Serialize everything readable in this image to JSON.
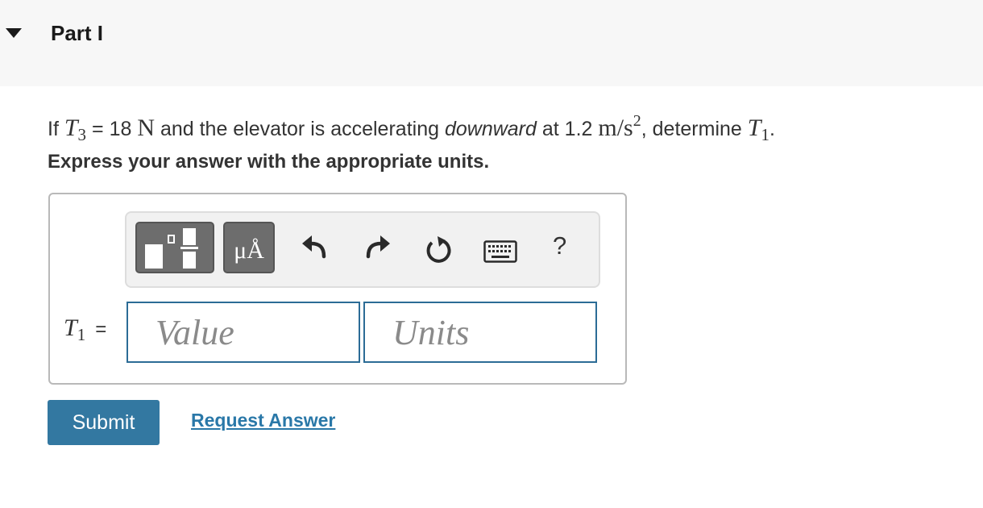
{
  "header": {
    "part_title": "Part I",
    "collapse_icon": "caret-down-icon"
  },
  "question": {
    "prefix": "If",
    "var_t3": "T",
    "var_t3_sub": "3",
    "equals": "=",
    "t3_value": "18",
    "t3_unit": "N",
    "middle": "and the elevator is accelerating",
    "emphasis": "downward",
    "at": "at",
    "accel_value": "1.2",
    "accel_unit": "m/s",
    "accel_unit_exp": "2",
    "determine": ", determine",
    "var_t1": "T",
    "var_t1_sub": "1",
    "end": "."
  },
  "instruction": "Express your answer with the appropriate units.",
  "toolbar": {
    "templates_icon": "templates-icon",
    "units_label": "μÅ",
    "undo_icon": "undo-icon",
    "redo_icon": "redo-icon",
    "reset_icon": "reset-icon",
    "keyboard_icon": "keyboard-icon",
    "help_label": "?"
  },
  "answer": {
    "var": "T",
    "var_sub": "1",
    "equals": "=",
    "value_placeholder": "Value",
    "value": "",
    "units_placeholder": "Units",
    "units": ""
  },
  "actions": {
    "submit_label": "Submit",
    "request_answer_label": "Request Answer"
  },
  "colors": {
    "header_bg": "#f7f7f7",
    "input_border": "#2c6c96",
    "submit_bg": "#3378a1",
    "link": "#2a78a8",
    "toolbar_button": "#6d6d6d"
  }
}
